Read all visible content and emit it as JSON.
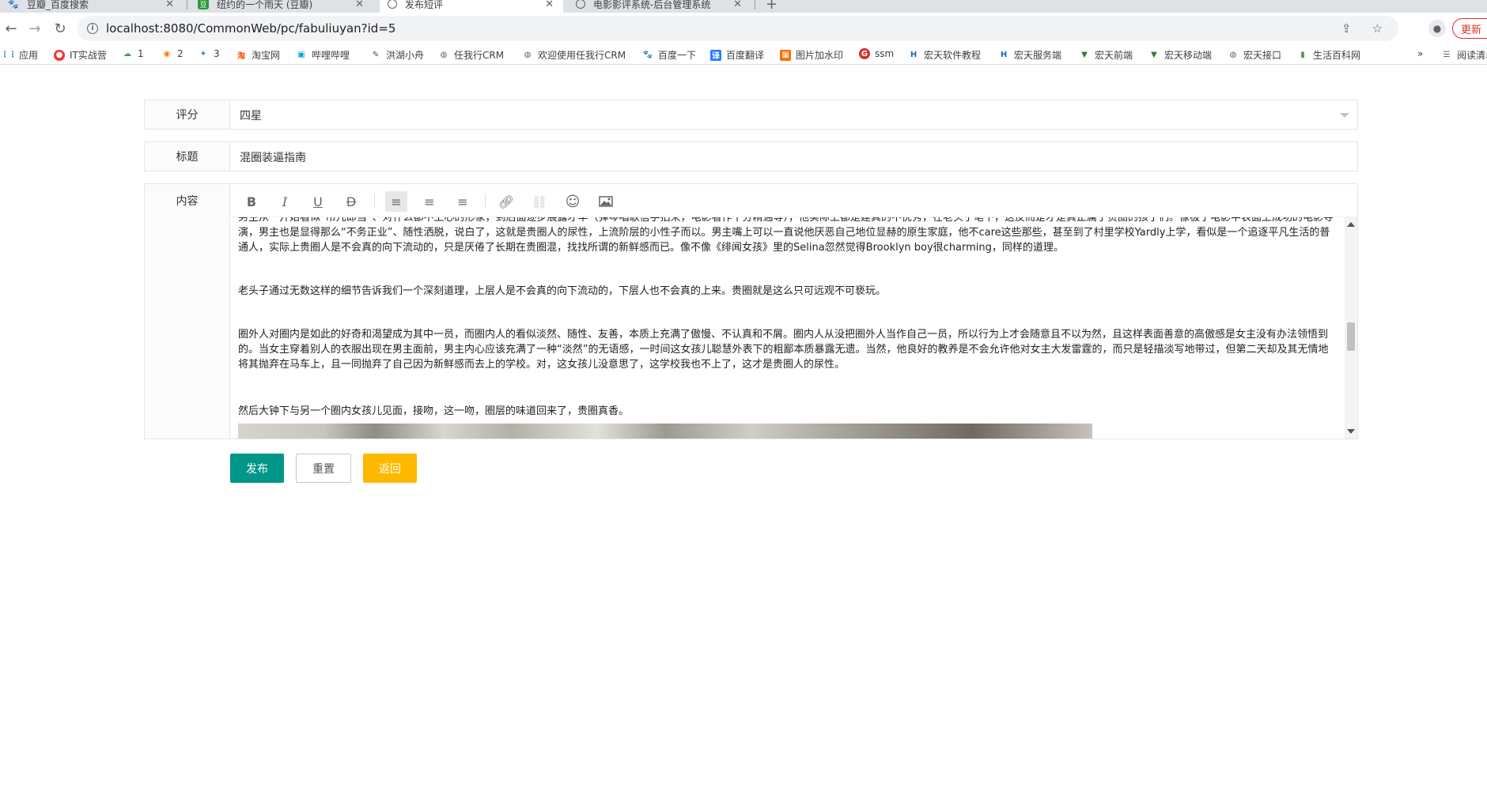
{
  "browser": {
    "tabs": [
      {
        "title": "豆瓣_百度搜索",
        "active": false
      },
      {
        "title": "纽约的一个雨天 (豆瓣)",
        "active": false
      },
      {
        "title": "发布短评",
        "active": true
      },
      {
        "title": "电影影评系统-后台管理系统",
        "active": false
      }
    ],
    "url": "localhost:8080/CommonWeb/pc/fabuliuyan?id=5",
    "update_label": "更新",
    "bookmarks": [
      "应用",
      "IT实战营",
      "1",
      "2",
      "3",
      "淘宝网",
      "哔哩哔哩",
      "洪湖小舟",
      "任我行CRM",
      "欢迎使用任我行CRM",
      "百度一下",
      "百度翻译",
      "图片加水印",
      "ssm",
      "宏天软件教程",
      "宏天服务端",
      "宏天前端",
      "宏天移动端",
      "宏天接口",
      "生活百科网",
      "阅读清单"
    ],
    "more_bookmarks": "»"
  },
  "form": {
    "rating_label": "评分",
    "rating_value": "四星",
    "title_label": "标题",
    "title_value": "混圈装逼指南",
    "content_label": "内容"
  },
  "editor": {
    "paragraphs": [
      "男主从一开始看似“吊儿郎当”、对什么都不上心的形象，到后面逐步展露才华（弹琴唱歌信手拈来，电影看作十分精通等），他实际上都是建真的不优秀，在老头子笔下，这反而是才是真正属于贵圈的孩子们。像极了电影中表面上成功的电影导演，男主也是显得那么“不务正业”、随性洒脱，说白了，这就是贵圈人的尿性，上流阶层的小性子而以。男主嘴上可以一直说他厌恶自己地位显赫的原生家庭，他不care这些那些，甚至到了村里学校Yardly上学，看似是一个追逐平凡生活的普通人，实际上贵圈人是不会真的向下流动的，只是厌倦了长期在贵圈混，找找所谓的新鲜感而已。像不像《绯闻女孩》里的Selina忽然觉得Brooklyn boy很charming，同样的道理。",
      "老头子通过无数这样的细节告诉我们一个深刻道理，上层人是不会真的向下流动的，下层人也不会真的上来。贵圈就是这么只可远观不可亵玩。",
      "圈外人对圈内是如此的好奇和渴望成为其中一员，而圈内人的看似淡然、随性、友善，本质上充满了傲慢、不认真和不屑。圈内人从没把圈外人当作自己一员，所以行为上才会随意且不以为然，且这样表面善意的高傲感是女主没有办法领悟到的。当女主穿着别人的衣服出现在男主面前，男主内心应该充满了一种“淡然”的无语感，一时间这女孩儿聪慧外表下的粗鄙本质暴露无遗。当然，他良好的教养是不会允许他对女主大发雷霆的，而只是轻描淡写地带过，但第二天却及其无情地将其抛弃在马车上，且一同抛弃了自己因为新鲜感而去上的学校。对，这女孩儿没意思了，这学校我也不上了，这才是贵圈人的尿性。",
      "然后大钟下与另一个圈内女孩儿见面，接吻，这一吻，圈层的味道回来了，贵圈真香。"
    ]
  },
  "actions": {
    "publish": "发布",
    "reset": "重置",
    "back": "返回"
  },
  "colors": {
    "primary": "#009688",
    "warm": "#ffb800",
    "update_red": "#d93025"
  }
}
